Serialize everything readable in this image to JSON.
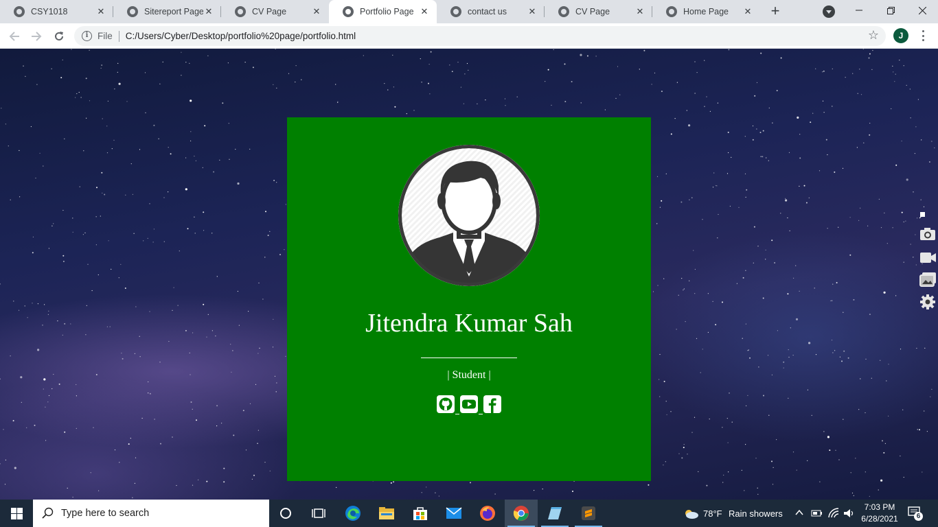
{
  "browser": {
    "tabs": [
      {
        "label": "CSY1018",
        "active": false
      },
      {
        "label": "Sitereport Page",
        "active": false
      },
      {
        "label": "CV Page",
        "active": false
      },
      {
        "label": "Portfolio Page",
        "active": true
      },
      {
        "label": "contact us",
        "active": false
      },
      {
        "label": "CV Page",
        "active": false
      },
      {
        "label": "Home Page",
        "active": false
      }
    ],
    "new_tab_glyph": "+",
    "address": {
      "scheme_label": "File",
      "url": "C:/Users/Cyber/Desktop/portfolio%20page/portfolio.html"
    },
    "profile_initial": "J"
  },
  "page": {
    "name": "Jitendra Kumar Sah",
    "role": "| Student |",
    "background_color": "#008000",
    "social_icons": [
      "github-icon",
      "youtube-icon",
      "facebook-icon"
    ]
  },
  "taskbar": {
    "search_placeholder": "Type here to search",
    "pinned_apps": [
      "cortana-icon",
      "task-view-icon",
      "edge-icon",
      "file-explorer-icon",
      "store-icon",
      "mail-icon",
      "firefox-icon",
      "chrome-icon",
      "notepad-icon",
      "sublime-text-icon"
    ],
    "weather": {
      "temp": "78°F",
      "condition": "Rain showers"
    },
    "clock": {
      "time": "7:03 PM",
      "date": "6/28/2021"
    },
    "notification_count": "6"
  },
  "colors": {
    "card": "#008000",
    "chrome_tabstrip": "#dee1e6",
    "taskbar": "#1c2a3a",
    "profile_avatar": "#0b5a3d"
  }
}
